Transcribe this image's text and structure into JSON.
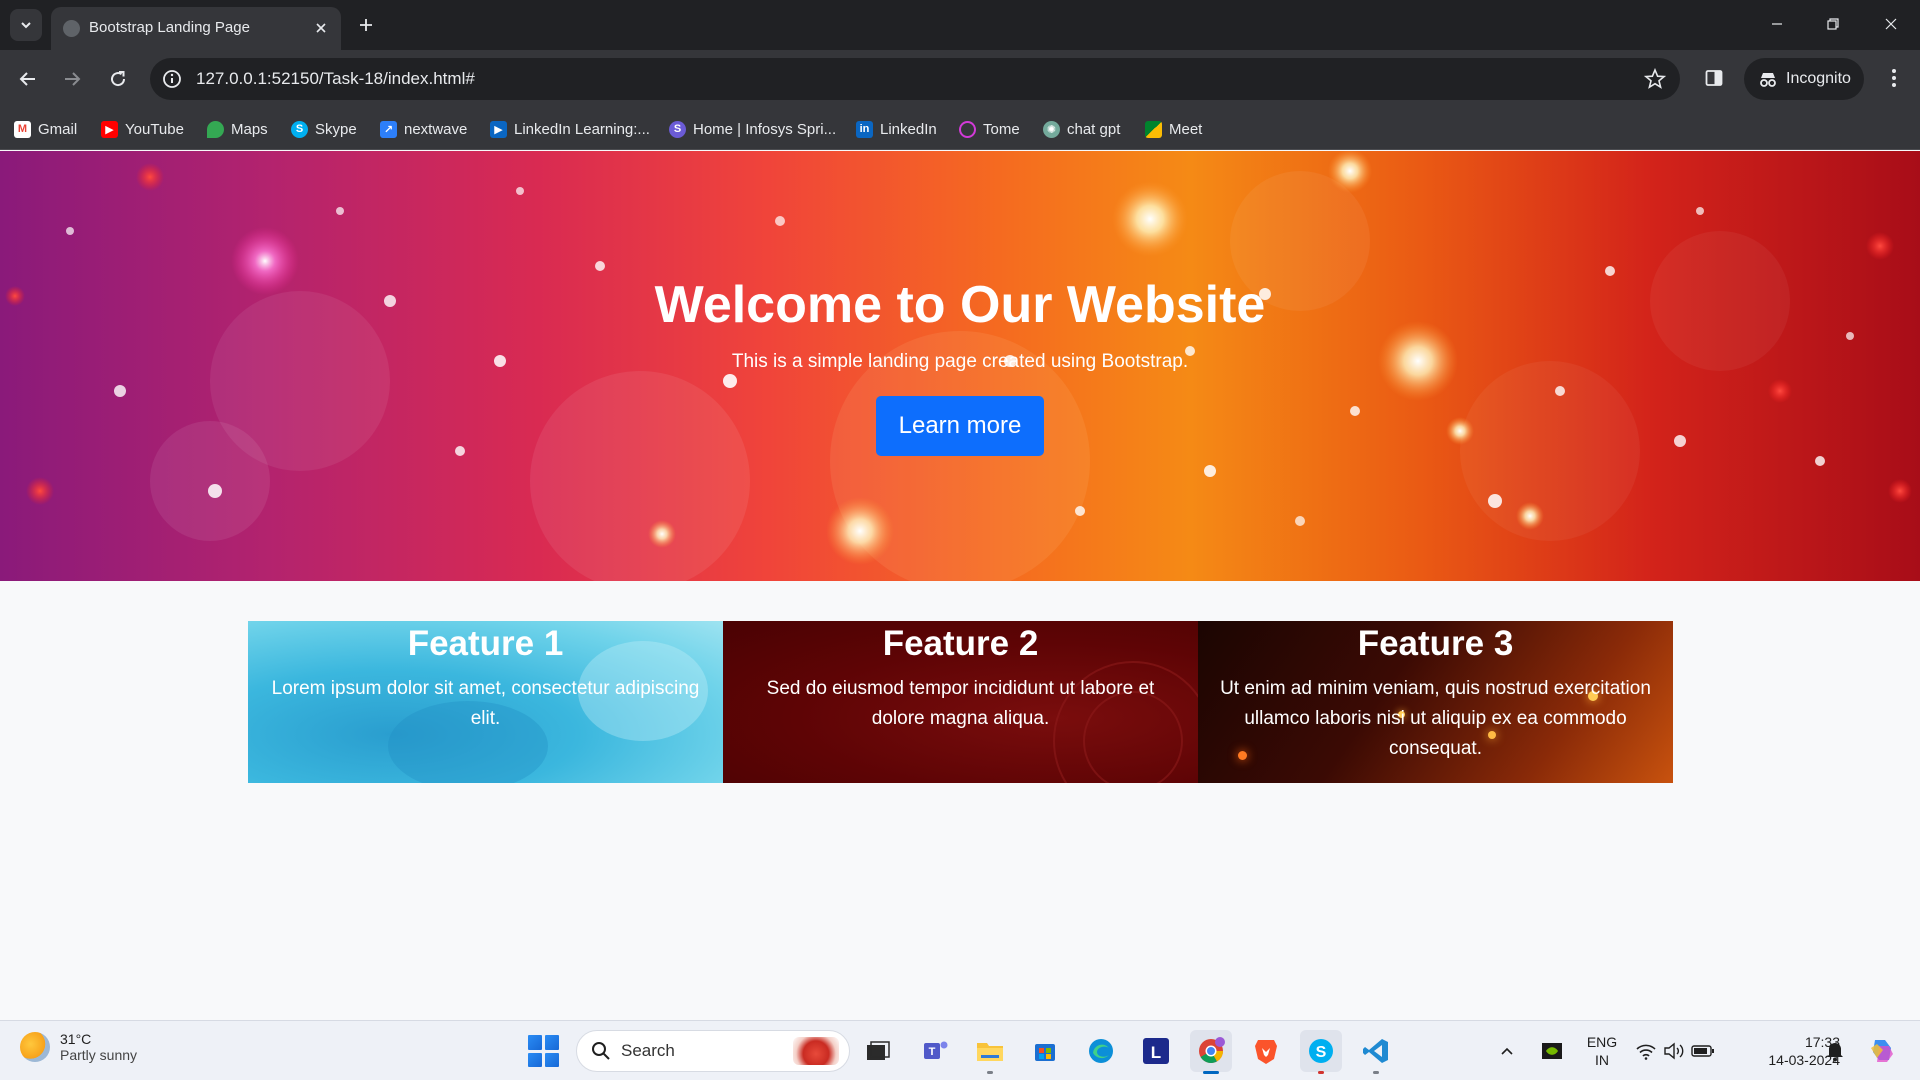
{
  "browser": {
    "tab_title": "Bootstrap Landing Page",
    "url": "127.0.0.1:52150/Task-18/index.html#",
    "incognito_label": "Incognito",
    "bookmarks": [
      {
        "label": "Gmail",
        "icon": "gmail-icon",
        "color": "#ea4335"
      },
      {
        "label": "YouTube",
        "icon": "youtube-icon",
        "color": "#ff0000"
      },
      {
        "label": "Maps",
        "icon": "maps-icon",
        "color": "#34a853"
      },
      {
        "label": "Skype",
        "icon": "skype-icon",
        "color": "#00aff0"
      },
      {
        "label": "nextwave",
        "icon": "nextwave-icon",
        "color": "#2d7ff9"
      },
      {
        "label": "LinkedIn Learning:...",
        "icon": "linkedin-learning-icon",
        "color": "#0a66c2"
      },
      {
        "label": "Home | Infosys Spri...",
        "icon": "infosys-icon",
        "color": "#6b5bd6"
      },
      {
        "label": "LinkedIn",
        "icon": "linkedin-icon",
        "color": "#0a66c2"
      },
      {
        "label": "Tome",
        "icon": "tome-icon",
        "color": "#d23ad8"
      },
      {
        "label": "chat gpt",
        "icon": "chatgpt-icon",
        "color": "#74aa9c"
      },
      {
        "label": "Meet",
        "icon": "meet-icon",
        "color": "#00832d"
      }
    ]
  },
  "hero": {
    "title": "Welcome to Our Website",
    "subtitle": "This is a simple landing page created using Bootstrap.",
    "button_label": "Learn more",
    "button_color": "#0d6efd"
  },
  "features": [
    {
      "title": "Feature 1",
      "text": "Lorem ipsum dolor sit amet, consectetur adipiscing elit."
    },
    {
      "title": "Feature 2",
      "text": "Sed do eiusmod tempor incididunt ut labore et dolore magna aliqua."
    },
    {
      "title": "Feature 3",
      "text": "Ut enim ad minim veniam, quis nostrud exercitation ullamco laboris nisi ut aliquip ex ea commodo consequat."
    }
  ],
  "taskbar": {
    "weather_temp": "31°C",
    "weather_desc": "Partly sunny",
    "search_placeholder": "Search",
    "language": "ENG",
    "region": "IN",
    "time": "17:33",
    "date": "14-03-2024"
  }
}
